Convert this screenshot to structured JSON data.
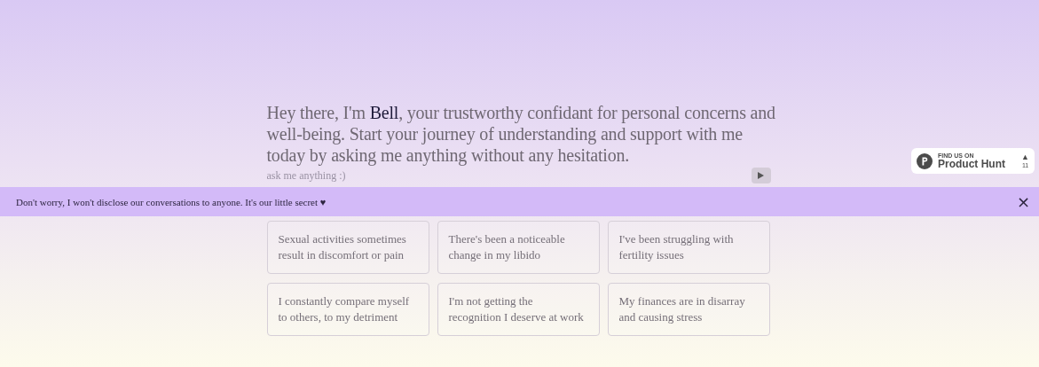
{
  "intro": "Hey there, I'm **Bell**, your trustworthy confidant for personal concerns and well-being. Start your journey of understanding and support with me today by asking me anything without any hesitation.",
  "input": {
    "placeholder": "ask me anything :)"
  },
  "suggestions": [
    {
      "text": "Sexual activities sometimes result in discomfort or pain"
    },
    {
      "text": "There's been a noticeable change in my libido"
    },
    {
      "text": "I've been struggling with fertility issues"
    },
    {
      "text": "I constantly compare myself to others, to my detriment"
    },
    {
      "text": "I'm not getting the recognition I deserve at work"
    },
    {
      "text": "My finances are in disarray and causing stress"
    }
  ],
  "banner": {
    "text": "Don't worry, I won't disclose our conversations to anyone. It's our little secret ♥",
    "close": "×"
  },
  "badge": {
    "caption": "FIND US ON",
    "name": "Product Hunt",
    "arrow": "▲",
    "count": "11"
  }
}
